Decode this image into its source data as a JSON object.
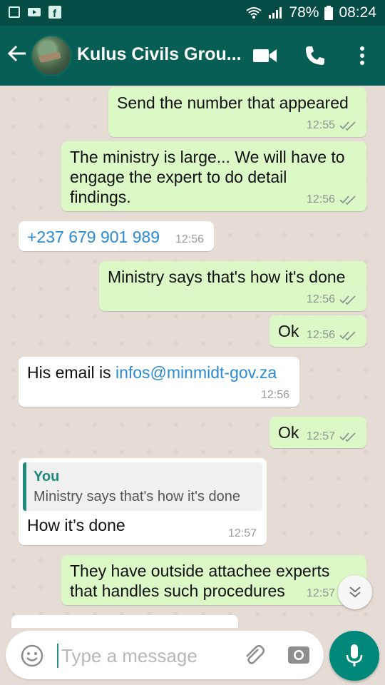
{
  "status_bar": {
    "battery": "78%",
    "time": "08:24",
    "left_icons": [
      "image-icon",
      "video-icon",
      "facebook-icon"
    ],
    "right_icons": [
      "wifi-icon",
      "signal-icon",
      "battery-icon"
    ]
  },
  "header": {
    "title": "Kulus Civils Grou...",
    "actions": [
      "video-call-icon",
      "phone-icon",
      "more-vert-icon"
    ]
  },
  "messages": [
    {
      "dir": "out",
      "text": "Send the number that appeared",
      "time": "12:55",
      "read": true
    },
    {
      "dir": "out",
      "text": "The ministry is large... We will have to engage the expert to do detail findings.",
      "time": "12:56",
      "read": true
    },
    {
      "dir": "in",
      "text": "+237 679 901 989",
      "time": "12:56"
    },
    {
      "dir": "out",
      "text": "Ministry says that's how it's done",
      "time": "12:56",
      "read": true
    },
    {
      "dir": "out",
      "text": "Ok",
      "time": "12:56",
      "read": true
    },
    {
      "dir": "in",
      "text_prefix": "His email is ",
      "link": "infos@minmidt-gov.za",
      "time": "12:56"
    },
    {
      "dir": "out",
      "text": "Ok",
      "time": "12:57",
      "read": true
    },
    {
      "dir": "in",
      "quote_author": "You",
      "quote_text": "Ministry says that's how it's done",
      "text": "How it’s done",
      "time": "12:57"
    },
    {
      "dir": "out",
      "text": "They have outside attachee experts that handles such procedures",
      "time": "12:57"
    }
  ],
  "composer": {
    "placeholder": "Type a message"
  },
  "colors": {
    "header": "#075e54",
    "status_bar": "#054d44",
    "outgoing_bubble": "#dcf8c6",
    "incoming_bubble": "#ffffff",
    "link": "#2a8ad4",
    "accent": "#00897b"
  }
}
